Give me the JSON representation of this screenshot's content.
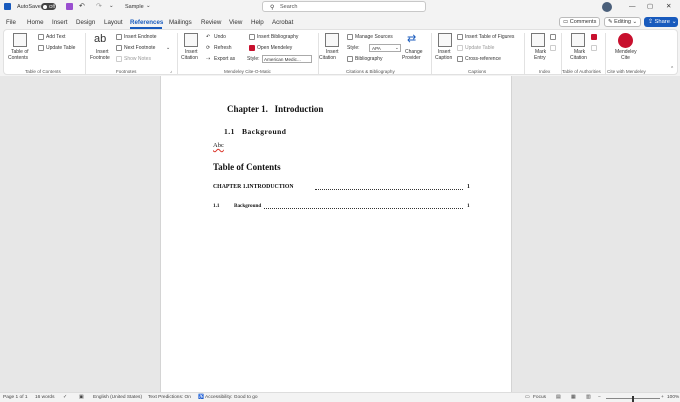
{
  "titlebar": {
    "autosave_label": "AutoSave",
    "autosave_state": "Off",
    "doc_name": "Sample",
    "search_placeholder": "Search",
    "account_initial": "",
    "min_glyph": "—",
    "max_glyph": "▢",
    "close_glyph": "✕"
  },
  "tabs": [
    "File",
    "Home",
    "Insert",
    "Design",
    "Layout",
    "References",
    "Mailings",
    "Review",
    "View",
    "Help",
    "Acrobat"
  ],
  "active_tab": "References",
  "actions": {
    "comments": "Comments",
    "editing": "Editing",
    "share": "Share"
  },
  "ribbon": {
    "toc": {
      "toc_button": "Table of",
      "toc_button_2": "Contents",
      "add_text": "Add Text",
      "update_table": "Update Table",
      "group": "Table of Contents"
    },
    "footnotes": {
      "insert_footnote": "Insert",
      "insert_footnote_2": "Footnote",
      "insert_endnote": "Insert Endnote",
      "next_footnote": "Next Footnote",
      "show_notes": "Show Notes",
      "group": "Footnotes",
      "ab_glyph": "ab"
    },
    "mendeley_cite_o_matic": {
      "insert_citation": "Insert",
      "insert_citation_2": "Citation",
      "undo": "Undo",
      "refresh": "Refresh",
      "export_as": "Export as",
      "insert_bibliography": "Insert Bibliography",
      "open_mendeley": "Open Mendeley",
      "style_label": "Style:",
      "style_value": "American Medic...",
      "group": "Mendeley Cite-O-Matic"
    },
    "citations": {
      "insert_citation": "Insert",
      "insert_citation_2": "Citation",
      "manage_sources": "Manage Sources",
      "style_label": "Style:",
      "style_value": "APA",
      "bibliography": "Bibliography",
      "change_provider": "Change",
      "change_provider_2": "Provider",
      "group": "Citations & Bibliography"
    },
    "captions": {
      "insert_caption": "Insert",
      "insert_caption_2": "Caption",
      "insert_table_of_figures": "Insert Table of Figures",
      "update_table": "Update Table",
      "cross_reference": "Cross-reference",
      "group": "Captions"
    },
    "index": {
      "mark_entry": "Mark",
      "mark_entry_2": "Entry",
      "group": "Index"
    },
    "authorities": {
      "mark_citation": "Mark",
      "mark_citation_2": "Citation",
      "group": "Table of Authorities"
    },
    "mendeley": {
      "cite": "Mendeley",
      "cite_2": "Cite",
      "group": "Cite with Mendeley"
    }
  },
  "document": {
    "chapter_heading": "Chapter 1.   Introduction",
    "section_heading": "1.1   Background",
    "body_text": "Abc",
    "toc_title": "Table of Contents",
    "toc_entries": [
      {
        "label": "CHAPTER 1.INTRODUCTION",
        "page": "1"
      },
      {
        "number": "1.1",
        "label": "Background",
        "page": "1"
      }
    ]
  },
  "status": {
    "page": "Page 1 of 1",
    "words": "16 words",
    "language": "English (United States)",
    "predictions": "Text Predictions: On",
    "accessibility": "Accessibility: Good to go",
    "focus": "Focus",
    "zoom": "100%"
  },
  "colors": {
    "accent": "#185abd",
    "mendeley": "#c8102e"
  }
}
